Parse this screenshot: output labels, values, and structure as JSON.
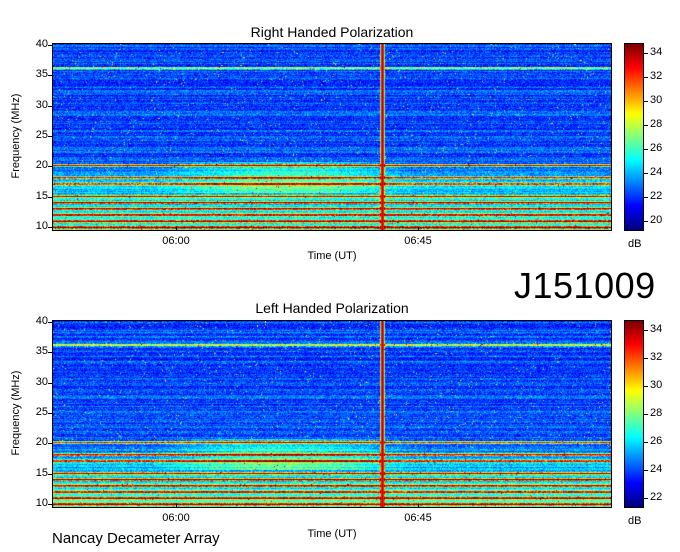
{
  "panels": [
    {
      "title": "Right Handed Polarization",
      "ylabel": "Frequency (MHz)",
      "xlabel": "Time (UT)",
      "y_ticks": [
        "40",
        "35",
        "30",
        "25",
        "20",
        "15",
        "10"
      ],
      "x_ticks": [
        "06:00",
        "06:45"
      ],
      "colorbar_ticks": [
        "34",
        "32",
        "30",
        "28",
        "26",
        "24",
        "22",
        "20"
      ],
      "colorbar_unit": "dB"
    },
    {
      "title": "Left Handed Polarization",
      "ylabel": "Frequency (MHz)",
      "xlabel": "Time (UT)",
      "y_ticks": [
        "40",
        "35",
        "30",
        "25",
        "20",
        "15",
        "10"
      ],
      "x_ticks": [
        "06:00",
        "06:45"
      ],
      "colorbar_ticks": [
        "34",
        "32",
        "30",
        "28",
        "26",
        "24",
        "22"
      ],
      "colorbar_unit": "dB"
    }
  ],
  "event_id": "J151009",
  "footer": "Nancay Decameter Array",
  "chart_data": [
    {
      "type": "heatmap",
      "title": "Right Handed Polarization",
      "xlabel": "Time (UT)",
      "ylabel": "Frequency (MHz)",
      "x_ticks": [
        "06:00",
        "06:45"
      ],
      "ylim": [
        10,
        40
      ],
      "colorbar": {
        "label": "dB",
        "range": [
          20,
          35
        ],
        "colormap": "jet"
      },
      "features": {
        "broadband_burst_time": "06:30",
        "persistent_bands_mhz": [
          10.5,
          11.5,
          12.5,
          13.5,
          14.5,
          15.5,
          17.5,
          18.5,
          20.5,
          36.2
        ]
      }
    },
    {
      "type": "heatmap",
      "title": "Left Handed Polarization",
      "xlabel": "Time (UT)",
      "ylabel": "Frequency (MHz)",
      "x_ticks": [
        "06:00",
        "06:45"
      ],
      "ylim": [
        10,
        40
      ],
      "colorbar": {
        "label": "dB",
        "range": [
          20.5,
          35
        ],
        "colormap": "jet"
      },
      "features": {
        "broadband_burst_time": "06:30",
        "persistent_bands_mhz": [
          10.5,
          11.5,
          12.5,
          13.5,
          14.5,
          15.5,
          17.5,
          18.5,
          20.5,
          36.2
        ]
      }
    }
  ]
}
